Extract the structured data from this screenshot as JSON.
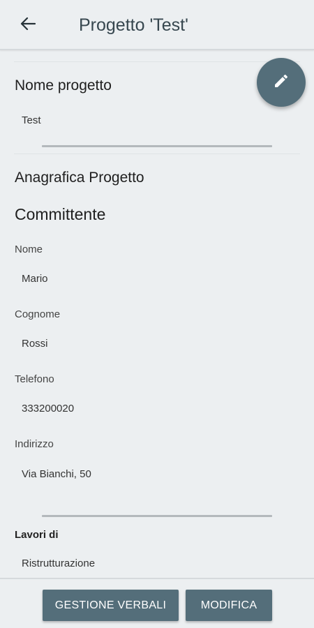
{
  "appbar": {
    "title": "Progetto 'Test'",
    "back_icon": "arrow-back-icon"
  },
  "fab": {
    "icon": "pencil-icon"
  },
  "project": {
    "name_heading": "Nome progetto",
    "name_value": "Test"
  },
  "registry": {
    "heading": "Anagrafica Progetto",
    "client_heading": "Committente",
    "fields": [
      {
        "label": "Nome",
        "value": "Mario"
      },
      {
        "label": "Cognome",
        "value": "Rossi"
      },
      {
        "label": "Telefono",
        "value": "333200020"
      },
      {
        "label": "Indirizzo",
        "value": "Via Bianchi, 50"
      }
    ]
  },
  "works": {
    "label": "Lavori di",
    "value": "Ristrutturazione"
  },
  "bottom": {
    "manage_button": "GESTIONE VERBALI",
    "edit_button": "MODIFICA"
  },
  "colors": {
    "accent": "#546e7a",
    "background": "#eceff1",
    "title": "#37474f"
  }
}
